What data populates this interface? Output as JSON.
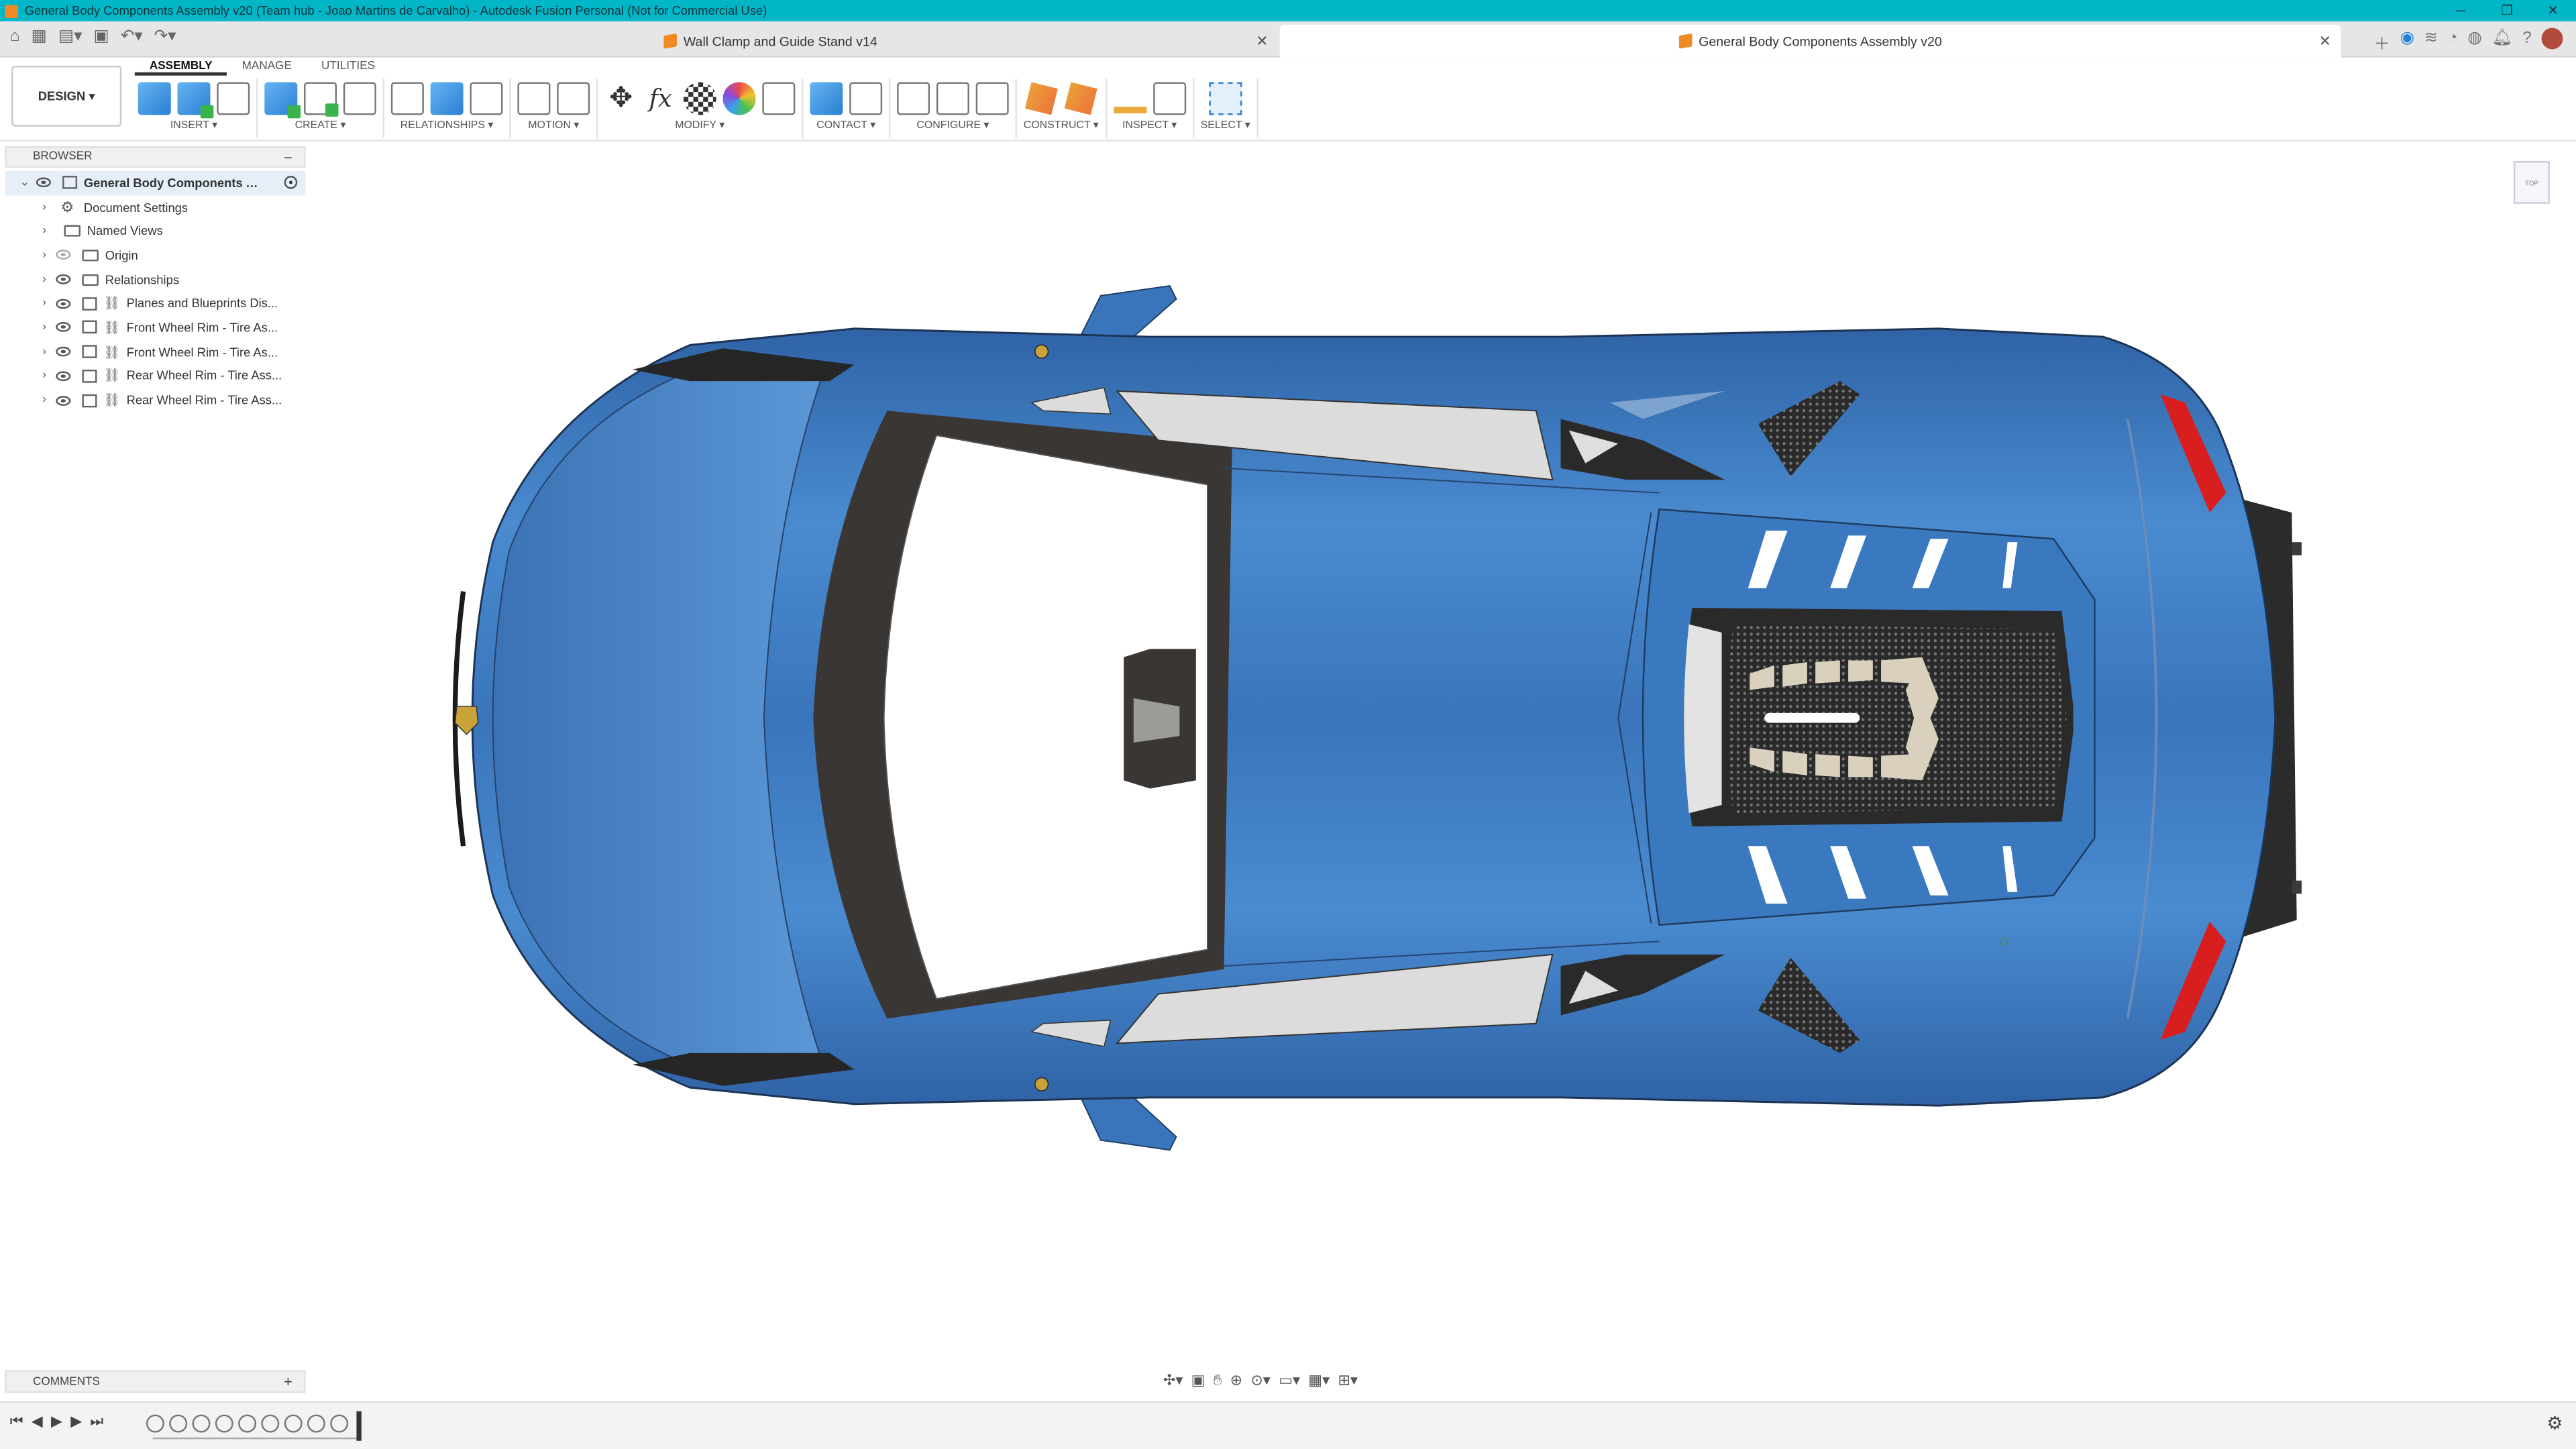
{
  "window": {
    "title": "General Body Components Assembly v20 (Team hub - Joao Martins de Carvalho) - Autodesk Fusion Personal (Not for Commercial Use)"
  },
  "tabs": [
    {
      "label": "Wall Clamp and Guide Stand v14",
      "active": false
    },
    {
      "label": "General Body Components Assembly v20",
      "active": true
    }
  ],
  "ribbon": {
    "workspace": "DESIGN",
    "workspace_tabs": [
      "ASSEMBLY",
      "MANAGE",
      "UTILITIES"
    ],
    "groups": [
      "INSERT",
      "CREATE",
      "RELATIONSHIPS",
      "MOTION",
      "MODIFY",
      "CONTACT",
      "CONFIGURE",
      "CONSTRUCT",
      "INSPECT",
      "SELECT"
    ]
  },
  "browser": {
    "title": "BROWSER",
    "root": "General Body Components A...",
    "items": [
      {
        "label": "Document Settings",
        "icon": "gear-icon"
      },
      {
        "label": "Named Views",
        "icon": "folder-icon"
      },
      {
        "label": "Origin",
        "icon": "folder-icon"
      },
      {
        "label": "Relationships",
        "icon": "folder-icon"
      },
      {
        "label": "Planes and Blueprints Dis...",
        "icon": "component-link-icon"
      },
      {
        "label": "Front Wheel Rim - Tire As...",
        "icon": "component-link-icon"
      },
      {
        "label": "Front Wheel Rim - Tire As...",
        "icon": "component-link-icon"
      },
      {
        "label": "Rear Wheel Rim - Tire Ass...",
        "icon": "component-link-icon"
      },
      {
        "label": "Rear Wheel Rim - Tire Ass...",
        "icon": "component-link-icon"
      }
    ]
  },
  "comments": {
    "label": "COMMENTS"
  },
  "colors": {
    "accent": "#00b6c7",
    "car_body": "#3d79bd",
    "glass": "#ffffff",
    "taillight": "#d81e1e"
  }
}
